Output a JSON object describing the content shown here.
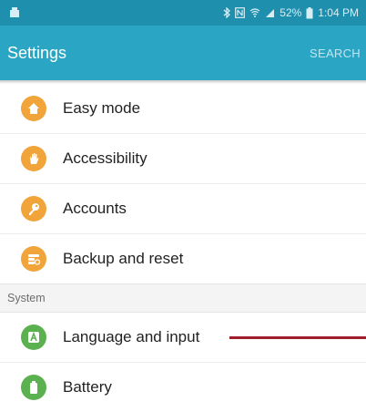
{
  "status_bar": {
    "battery_percent": "52%",
    "time": "1:04 PM",
    "icons": [
      "notification-icon",
      "bluetooth-icon",
      "nfc-icon",
      "wifi-icon",
      "signal-icon",
      "battery-icon"
    ]
  },
  "app_bar": {
    "title": "Settings",
    "search_label": "SEARCH"
  },
  "items": [
    {
      "label": "Easy mode",
      "icon": "home-icon"
    },
    {
      "label": "Accessibility",
      "icon": "hand-icon"
    },
    {
      "label": "Accounts",
      "icon": "key-icon"
    },
    {
      "label": "Backup and reset",
      "icon": "backup-icon"
    }
  ],
  "section": {
    "label": "System"
  },
  "system_items": [
    {
      "label": "Language and input",
      "icon": "language-icon"
    },
    {
      "label": "Battery",
      "icon": "battery-icon"
    }
  ],
  "colors": {
    "status_bar": "#1f8fae",
    "app_bar": "#2aa6c4",
    "icon_orange": "#f0a43a",
    "icon_green": "#5bb14f",
    "pointer_line": "#a01e2a"
  }
}
